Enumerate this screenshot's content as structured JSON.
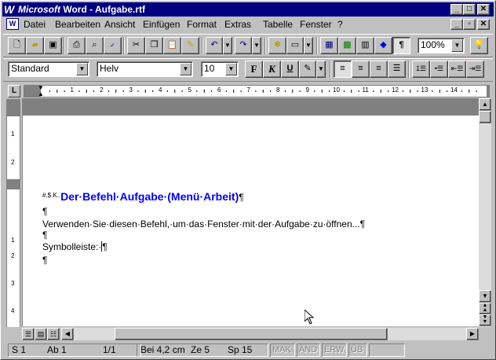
{
  "title": "Microsoft Word - Aufgabe.rtf",
  "title_brand": "Microsoft",
  "title_rest": " Word - Aufgabe.rtf",
  "window_buttons": [
    "_",
    "□",
    "✕"
  ],
  "doc_buttons": [
    "_",
    "▫",
    "✕"
  ],
  "menu": [
    "Datei",
    "Bearbeiten",
    "Ansicht",
    "Einfügen",
    "Format",
    "Extras",
    "Tabelle",
    "Fenster",
    "?"
  ],
  "formatting": {
    "style": "Standard",
    "font": "Helv",
    "size": "10",
    "zoom": "100%"
  },
  "ruler": {
    "numbers": [
      "1",
      "2",
      "3",
      "4",
      "5",
      "6",
      "7",
      "8",
      "9",
      "10",
      "11",
      "12",
      "13",
      "14"
    ]
  },
  "vruler": [
    "1",
    "2",
    "1",
    "2",
    "3",
    "4"
  ],
  "document": {
    "markers": "#.$.K..",
    "heading": "Der·Befehl·Aufgabe·(Menü·Arbeit)",
    "pilcrow": "¶",
    "body1": "Verwenden·Sie·diesen·Befehl,·um·das·Fenster·mit·der·Aufgabe·zu·öffnen...¶",
    "label": "Symbolleiste:·",
    "label_end": "¶"
  },
  "statusbar": {
    "section": "S 1",
    "page": "Ab 1",
    "pages": "1/1",
    "pos": "Bei 4,2 cm",
    "line": "Ze 5",
    "col": "Sp 15",
    "mak": "MAK",
    "and": "ÄND",
    "erw": "ERW",
    "ub": "ÜB"
  },
  "colors": {
    "titlebar": "#000080",
    "heading": "#0000ff"
  }
}
